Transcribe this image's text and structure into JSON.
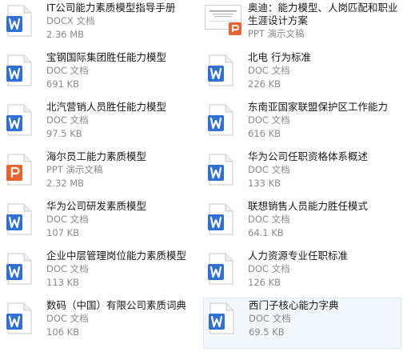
{
  "files": [
    {
      "name": "IT公司能力素质模型指导手册",
      "type": "DOCX 文档",
      "size": "2.36 MB",
      "icon": "word-icon"
    },
    {
      "name": "奥迪：能力模型、人岗匹配和职业生涯设计方案",
      "type": "PPT 演示文稿",
      "size": "",
      "icon": "ppt-thumbnail"
    },
    {
      "name": "宝钢国际集团胜任能力模型",
      "type": "DOC 文档",
      "size": "691 KB",
      "icon": "word-icon"
    },
    {
      "name": "北电 行为标准",
      "type": "DOC 文档",
      "size": "226 KB",
      "icon": "word-icon"
    },
    {
      "name": "北汽营销人员胜任能力模型",
      "type": "DOC 文档",
      "size": "97.5 KB",
      "icon": "word-icon"
    },
    {
      "name": "东南亚国家联盟保护区工作能力",
      "type": "DOC 文档",
      "size": "616 KB",
      "icon": "word-icon"
    },
    {
      "name": "海尔员工能力素质模型",
      "type": "PPT 演示文稿",
      "size": "2.32 MB",
      "icon": "ppt-icon"
    },
    {
      "name": "华为公司任职资格体系概述",
      "type": "DOC 文档",
      "size": "133 KB",
      "icon": "word-icon"
    },
    {
      "name": "华为公司研发素质模型",
      "type": "DOC 文档",
      "size": "107 KB",
      "icon": "word-icon"
    },
    {
      "name": "联想销售人员能力胜任模式",
      "type": "DOC 文档",
      "size": "64.1 KB",
      "icon": "word-icon"
    },
    {
      "name": "企业中层管理岗位能力素质模型",
      "type": "DOC 文档",
      "size": "113 KB",
      "icon": "word-icon"
    },
    {
      "name": "人力资源专业任职标准",
      "type": "DOC 文档",
      "size": "126 KB",
      "icon": "word-icon"
    },
    {
      "name": "数码（中国）有限公司素质词典",
      "type": "DOC 文档",
      "size": "106 KB",
      "icon": "word-icon"
    },
    {
      "name": "西门子核心能力字典",
      "type": "DOC 文档",
      "size": "69.5 KB",
      "icon": "word-icon"
    }
  ],
  "colors": {
    "word": "#2f6fd6",
    "ppt": "#e8632f",
    "text": "#1a1a1a",
    "meta": "#8a8a8a"
  }
}
